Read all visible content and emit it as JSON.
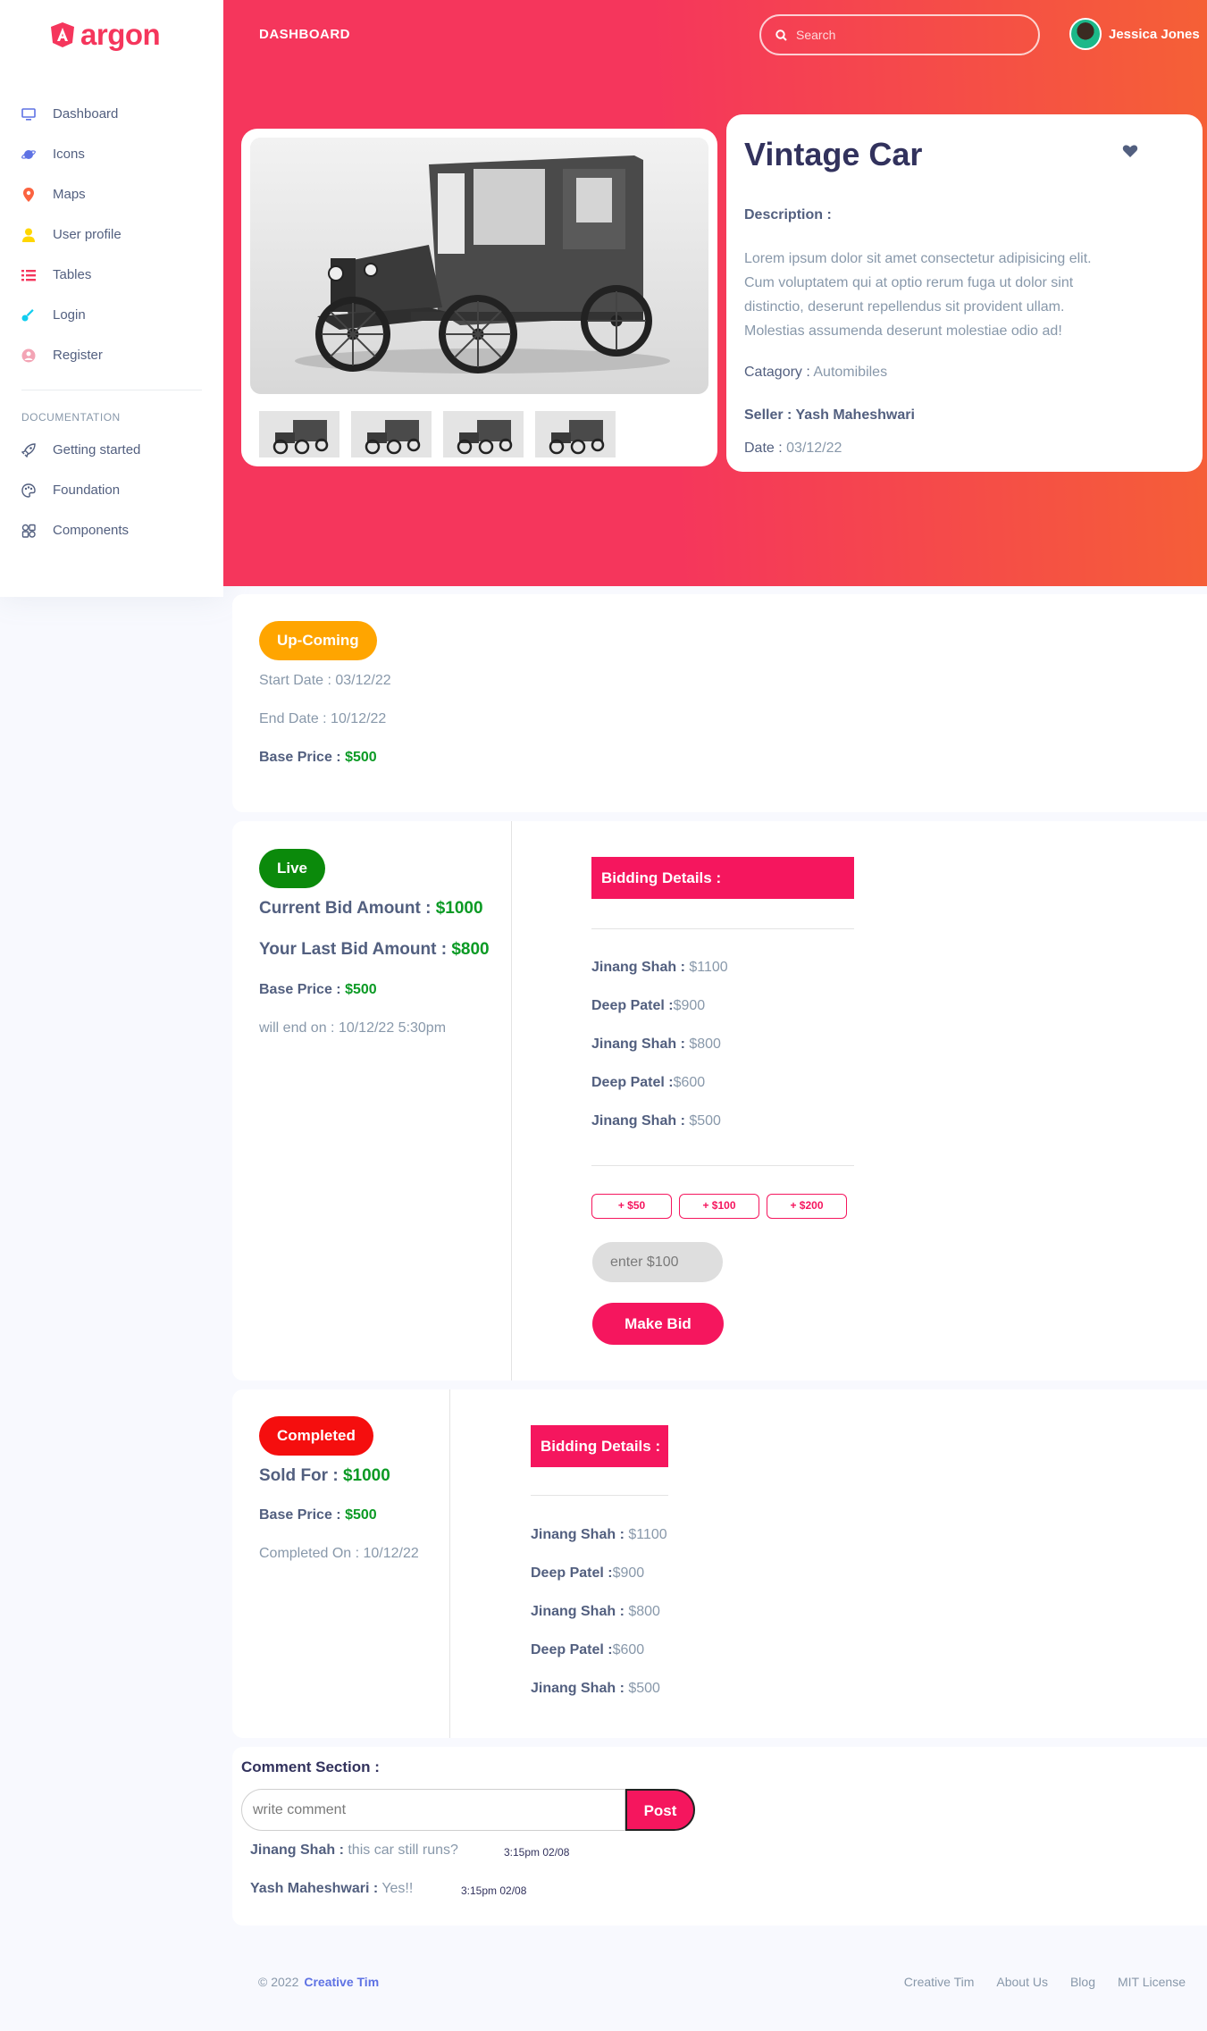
{
  "brand": {
    "name": "argon"
  },
  "sidebar": {
    "items": [
      {
        "label": "Dashboard",
        "icon": "tv-icon",
        "color": "#5e72e4"
      },
      {
        "label": "Icons",
        "icon": "planet-icon",
        "color": "#5e72e4"
      },
      {
        "label": "Maps",
        "icon": "pin-icon",
        "color": "#fb6340"
      },
      {
        "label": "User profile",
        "icon": "user-icon",
        "color": "#ffd600"
      },
      {
        "label": "Tables",
        "icon": "list-icon",
        "color": "#f5365c"
      },
      {
        "label": "Login",
        "icon": "key-icon",
        "color": "#11cdef"
      },
      {
        "label": "Register",
        "icon": "circle-user-icon",
        "color": "#f3a4b5"
      }
    ],
    "doc_heading": "DOCUMENTATION",
    "doc_items": [
      {
        "label": "Getting started",
        "icon": "rocket-icon"
      },
      {
        "label": "Foundation",
        "icon": "palette-icon"
      },
      {
        "label": "Components",
        "icon": "ui-components-icon"
      }
    ]
  },
  "header": {
    "title": "DASHBOARD",
    "search_placeholder": "Search",
    "user_name": "Jessica Jones"
  },
  "product": {
    "title": "Vintage Car",
    "description_label": "Description :",
    "description": "Lorem ipsum dolor sit amet consectetur adipisicing elit. Cum voluptatem qui at optio rerum fuga ut dolor sint distinctio, deserunt repellendus sit provident ullam. Molestias assumenda deserunt molestiae odio ad!",
    "category_label": "Catagory :",
    "category": "Automibiles",
    "seller_label": "Seller :",
    "seller": "Yash Maheshwari",
    "date_label": "Date :",
    "date": "03/12/22",
    "thumbnail_count": 4
  },
  "upcoming": {
    "badge": "Up-Coming",
    "badge_color": "#ffa500",
    "start_date": "Start Date : 03/12/22",
    "end_date": "End Date : 10/12/22",
    "base_price_label": "Base Price :",
    "base_price": "$500"
  },
  "live": {
    "badge": "Live",
    "badge_color": "#0b8a0b",
    "current_bid_label": "Current Bid Amount :",
    "current_bid": "$1000",
    "last_bid_label": "Your Last Bid Amount :",
    "last_bid": "$800",
    "base_price_label": "Base Price :",
    "base_price": "$500",
    "ends": "will end on : 10/12/22 5:30pm",
    "bidding_title": "Bidding Details :",
    "bids": [
      {
        "name": "Jinang Shah :",
        "amount": " $1100"
      },
      {
        "name": "Deep Patel :",
        "amount": "$900"
      },
      {
        "name": "Jinang Shah :",
        "amount": " $800"
      },
      {
        "name": "Deep Patel :",
        "amount": "$600"
      },
      {
        "name": "Jinang Shah :",
        "amount": " $500"
      }
    ],
    "increments": [
      "+ $50",
      "+ $100",
      "+ $200"
    ],
    "bid_input_placeholder": "enter $100",
    "make_bid": "Make Bid"
  },
  "completed": {
    "badge": "Completed",
    "badge_color": "#f50e0e",
    "sold_label": "Sold For :",
    "sold": "$1000",
    "base_price_label": "Base Price :",
    "base_price": "$500",
    "completed_on": "Completed On : 10/12/22",
    "bidding_title": "Bidding Details :",
    "bids": [
      {
        "name": "Jinang Shah :",
        "amount": " $1100"
      },
      {
        "name": "Deep Patel :",
        "amount": "$900"
      },
      {
        "name": "Jinang Shah :",
        "amount": " $800"
      },
      {
        "name": "Deep Patel :",
        "amount": "$600"
      },
      {
        "name": "Jinang Shah :",
        "amount": " $500"
      }
    ]
  },
  "comments": {
    "title": "Comment Section :",
    "placeholder": "write comment",
    "post": "Post",
    "items": [
      {
        "author": "Jinang Shah :",
        "text": " this car still runs?",
        "time": "3:15pm 02/08"
      },
      {
        "author": "Yash Maheshwari :",
        "text": " Yes!!",
        "time": "3:15pm 02/08"
      }
    ]
  },
  "footer": {
    "copyright": "© 2022",
    "brand_link": "Creative Tim",
    "links": [
      "Creative Tim",
      "About Us",
      "Blog",
      "MIT License"
    ]
  }
}
